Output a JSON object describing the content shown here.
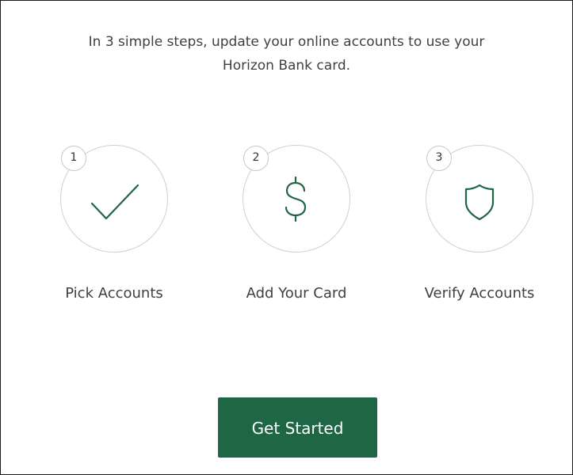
{
  "intro": {
    "line1": "In 3 simple steps, update your online accounts to use your",
    "line2": "Horizon Bank card."
  },
  "steps": [
    {
      "number": "1",
      "label": "Pick Accounts",
      "icon": "checkmark-icon"
    },
    {
      "number": "2",
      "label": "Add Your Card",
      "icon": "dollar-icon"
    },
    {
      "number": "3",
      "label": "Verify Accounts",
      "icon": "shield-icon"
    }
  ],
  "cta": {
    "label": "Get Started"
  },
  "colors": {
    "brand_green": "#1f6645",
    "circle_border": "#d0d0d0",
    "text": "#404040"
  }
}
